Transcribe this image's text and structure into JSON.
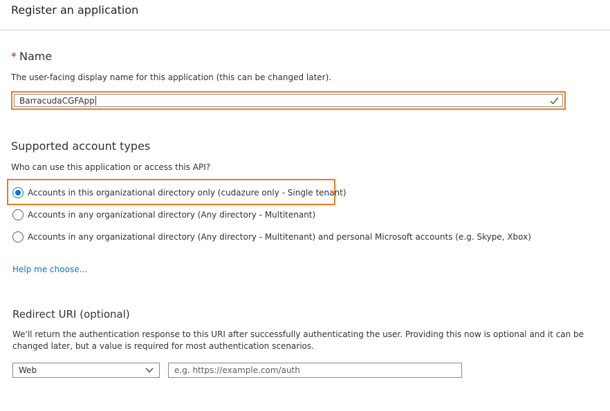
{
  "page": {
    "title": "Register an application"
  },
  "name_section": {
    "required_marker": "*",
    "title": "Name",
    "description": "The user-facing display name for this application (this can be changed later).",
    "input_value": "BarracudaCGFApp",
    "valid_icon": "checkmark-icon",
    "highlight_color": "#f07b1d",
    "valid_color": "#107c10"
  },
  "account_types": {
    "title": "Supported account types",
    "question": "Who can use this application or access this API?",
    "options": [
      {
        "label": "Accounts in this organizational directory only (cudazure only - Single tenant)",
        "selected": true
      },
      {
        "label": "Accounts in any organizational directory (Any directory - Multitenant)",
        "selected": false
      },
      {
        "label": "Accounts in any organizational directory (Any directory - Multitenant) and personal Microsoft accounts (e.g. Skype, Xbox)",
        "selected": false
      }
    ],
    "help_link": "Help me choose...",
    "accent_color": "#0078d4"
  },
  "redirect_uri": {
    "title": "Redirect URI (optional)",
    "description_line1": "We'll return the authentication response to this URI after successfully authenticating the user. Providing this now is optional and it can be",
    "description_line2": "changed later, but a value is required for most authentication scenarios.",
    "platform_selected": "Web",
    "dropdown_icon": "chevron-down-icon",
    "uri_value": "",
    "uri_placeholder": "e.g. https://example.com/auth"
  }
}
